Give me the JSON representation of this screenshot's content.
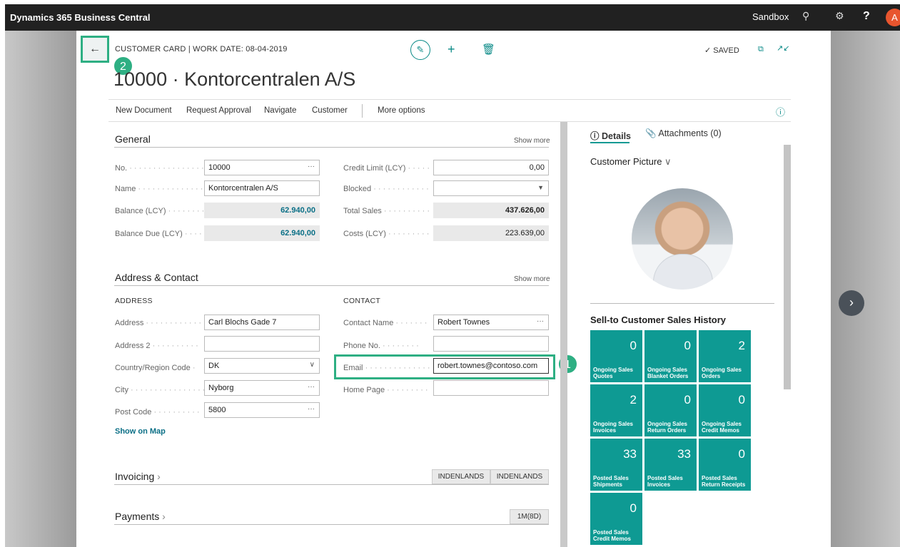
{
  "app": {
    "title": "Dynamics 365 Business Central",
    "environment": "Sandbox",
    "avatar_letter": "A",
    "help_label": "?"
  },
  "header": {
    "breadcrumb": "CUSTOMER CARD | WORK DATE: 08-04-2019",
    "title": "10000 · Kontorcentralen A/S",
    "status": "SAVED"
  },
  "callouts": {
    "one": "1",
    "two": "2"
  },
  "actions": [
    "New Document",
    "Request Approval",
    "Navigate",
    "Customer",
    "More options"
  ],
  "general": {
    "title": "General",
    "show_more": "Show more",
    "fields": {
      "no_label": "No.",
      "no_value": "10000",
      "name_label": "Name",
      "name_value": "Kontorcentralen A/S",
      "balance_label": "Balance (LCY)",
      "balance_value": "62.940,00",
      "balance_due_label": "Balance Due (LCY)",
      "balance_due_value": "62.940,00",
      "credit_limit_label": "Credit Limit (LCY)",
      "credit_limit_value": "0,00",
      "blocked_label": "Blocked",
      "blocked_value": "",
      "total_sales_label": "Total Sales",
      "total_sales_value": "437.626,00",
      "costs_label": "Costs (LCY)",
      "costs_value": "223.639,00"
    }
  },
  "address_contact": {
    "title": "Address & Contact",
    "show_more": "Show more",
    "address_header": "ADDRESS",
    "contact_header": "CONTACT",
    "address_label": "Address",
    "address_value": "Carl Blochs Gade 7",
    "address2_label": "Address 2",
    "address2_value": "",
    "country_label": "Country/Region Code",
    "country_value": "DK",
    "city_label": "City",
    "city_value": "Nyborg",
    "post_code_label": "Post Code",
    "post_code_value": "5800",
    "contact_name_label": "Contact Name",
    "contact_name_value": "Robert Townes",
    "phone_label": "Phone No.",
    "phone_value": "",
    "email_label": "Email",
    "email_value": "robert.townes@contoso.com",
    "home_page_label": "Home Page",
    "home_page_value": "",
    "show_on_map": "Show on Map"
  },
  "invoicing": {
    "title": "Invoicing",
    "pill1": "INDENLANDS",
    "pill2": "INDENLANDS"
  },
  "payments": {
    "title": "Payments",
    "pill": "1M(8D)"
  },
  "factbox": {
    "tab_details": "Details",
    "tab_attachments": "Attachments (0)",
    "picture_title": "Customer Picture",
    "history_title": "Sell-to Customer Sales History",
    "tiles": [
      {
        "value": "0",
        "label1": "Ongoing Sales",
        "label2": "Quotes"
      },
      {
        "value": "0",
        "label1": "Ongoing Sales",
        "label2": "Blanket Orders"
      },
      {
        "value": "2",
        "label1": "Ongoing Sales",
        "label2": "Orders"
      },
      {
        "value": "2",
        "label1": "Ongoing Sales",
        "label2": "Invoices"
      },
      {
        "value": "0",
        "label1": "Ongoing Sales",
        "label2": "Return Orders"
      },
      {
        "value": "0",
        "label1": "Ongoing Sales",
        "label2": "Credit Memos"
      },
      {
        "value": "33",
        "label1": "Posted Sales",
        "label2": "Shipments"
      },
      {
        "value": "33",
        "label1": "Posted Sales",
        "label2": "Invoices"
      },
      {
        "value": "0",
        "label1": "Posted Sales",
        "label2": "Return Receipts"
      },
      {
        "value": "0",
        "label1": "Posted Sales",
        "label2": "Credit Memos"
      }
    ]
  },
  "colors": {
    "accent": "#0e9a93",
    "callout": "#2eaf83",
    "topbar": "#212121"
  }
}
